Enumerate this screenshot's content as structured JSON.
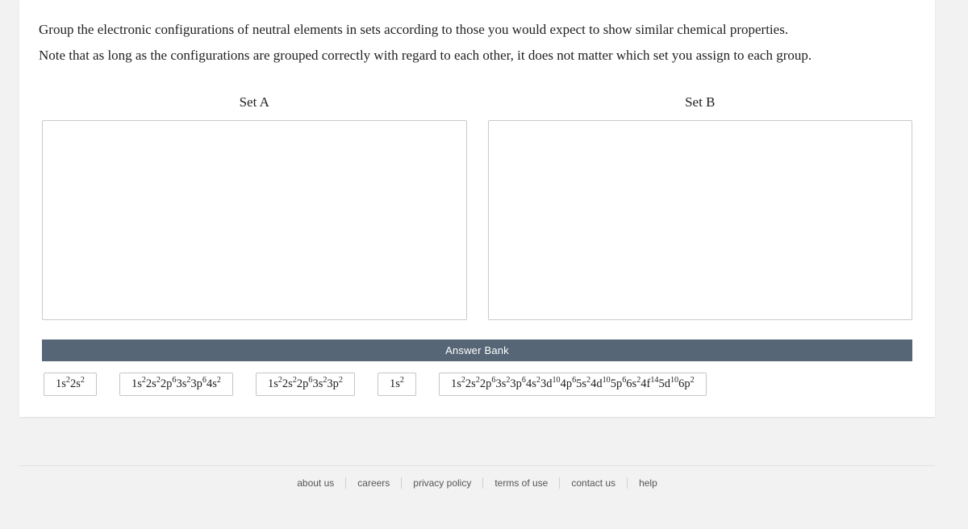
{
  "question": {
    "instructions": "Group the electronic configurations of neutral elements in sets according to those you would expect to show similar chemical properties.",
    "note": "Note that as long as the configurations are grouped correctly with regard to each other, it does not matter which set you assign to each group."
  },
  "sets": {
    "a": {
      "title": "Set A"
    },
    "b": {
      "title": "Set B"
    }
  },
  "bank": {
    "header": "Answer Bank",
    "tiles": [
      {
        "config_html": "1s<sup>2</sup>2s<sup>2</sup>"
      },
      {
        "config_html": "1s<sup>2</sup>2s<sup>2</sup>2p<sup>6</sup>3s<sup>2</sup>3p<sup>6</sup>4s<sup>2</sup>"
      },
      {
        "config_html": "1s<sup>2</sup>2s<sup>2</sup>2p<sup>6</sup>3s<sup>2</sup>3p<sup>2</sup>"
      },
      {
        "config_html": "1s<sup>2</sup>"
      },
      {
        "config_html": "1s<sup>2</sup>2s<sup>2</sup>2p<sup>6</sup>3s<sup>2</sup>3p<sup>6</sup>4s<sup>2</sup>3d<sup>10</sup>4p<sup>6</sup>5s<sup>2</sup>4d<sup>10</sup>5p<sup>6</sup>6s<sup>2</sup>4f<sup>14</sup>5d<sup>10</sup>6p<sup>2</sup>"
      }
    ]
  },
  "footer": {
    "links": [
      "about us",
      "careers",
      "privacy policy",
      "terms of use",
      "contact us",
      "help"
    ]
  }
}
